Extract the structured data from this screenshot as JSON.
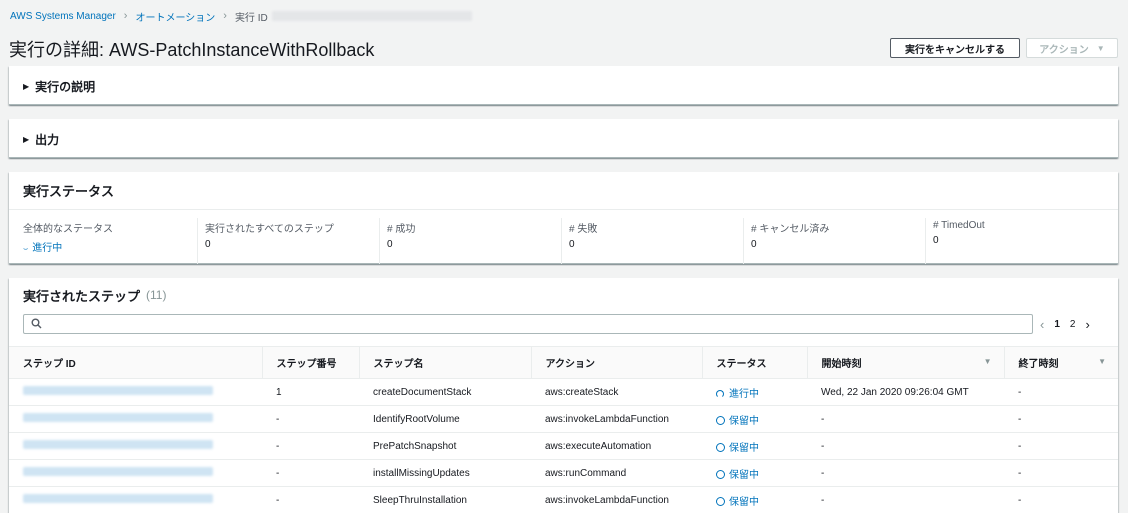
{
  "breadcrumb": {
    "root": "AWS Systems Manager",
    "section": "オートメーション",
    "current": "実行 ID"
  },
  "page_title": "実行の詳細: AWS-PatchInstanceWithRollback",
  "buttons": {
    "cancel": "実行をキャンセルする",
    "actions": "アクション"
  },
  "panels": {
    "description": "実行の説明",
    "output": "出力",
    "status_title": "実行ステータス"
  },
  "status": [
    {
      "label": "全体的なステータス",
      "value": "進行中"
    },
    {
      "label": "実行されたすべてのステップ",
      "value": "0"
    },
    {
      "label": "# 成功",
      "value": "0"
    },
    {
      "label": "# 失敗",
      "value": "0"
    },
    {
      "label": "# キャンセル済み",
      "value": "0"
    },
    {
      "label": "# TimedOut",
      "value": "0"
    }
  ],
  "steps": {
    "title": "実行されたステップ",
    "count": "(11)",
    "pager": {
      "page1": "1",
      "page2": "2"
    },
    "columns": [
      "ステップ ID",
      "ステップ番号",
      "ステップ名",
      "アクション",
      "ステータス",
      "開始時刻",
      "終了時刻"
    ],
    "rows": [
      {
        "num": "1",
        "name": "createDocumentStack",
        "action": "aws:createStack",
        "status": "進行中",
        "start": "Wed, 22 Jan 2020 09:26:04 GMT",
        "end": "-"
      },
      {
        "num": "-",
        "name": "IdentifyRootVolume",
        "action": "aws:invokeLambdaFunction",
        "status": "保留中",
        "start": "-",
        "end": "-"
      },
      {
        "num": "-",
        "name": "PrePatchSnapshot",
        "action": "aws:executeAutomation",
        "status": "保留中",
        "start": "-",
        "end": "-"
      },
      {
        "num": "-",
        "name": "installMissingUpdates",
        "action": "aws:runCommand",
        "status": "保留中",
        "start": "-",
        "end": "-"
      },
      {
        "num": "-",
        "name": "SleepThruInstallation",
        "action": "aws:invokeLambdaFunction",
        "status": "保留中",
        "start": "-",
        "end": "-"
      }
    ]
  }
}
